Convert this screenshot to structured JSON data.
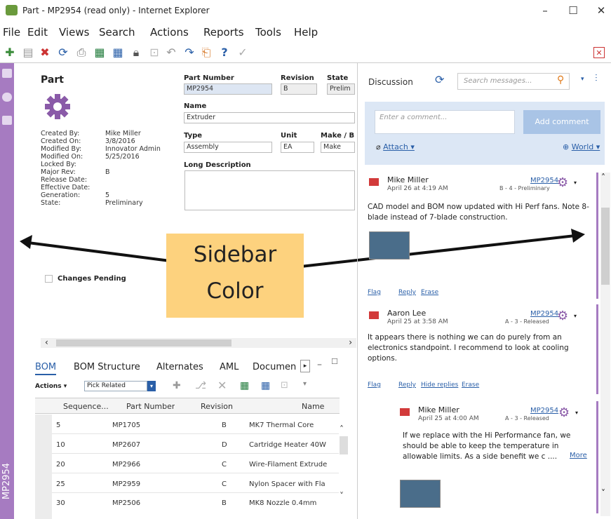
{
  "window": {
    "title": "Part - MP2954 (read only) - Internet Explorer",
    "min": "–",
    "max": "☐",
    "close": "✕"
  },
  "menu": [
    "File",
    "Edit",
    "Views",
    "Search",
    "Actions",
    "Reports",
    "Tools",
    "Help"
  ],
  "sidebar": {
    "color": "#a67bc1",
    "vertical_label": "MP2954"
  },
  "part": {
    "heading": "Part",
    "meta": [
      {
        "label": "Created By:",
        "value": "Mike Miller"
      },
      {
        "label": "Created On:",
        "value": "3/8/2016"
      },
      {
        "label": "Modified By:",
        "value": "Innovator Admin"
      },
      {
        "label": "Modified On:",
        "value": "5/25/2016"
      },
      {
        "label": "Locked By:",
        "value": ""
      },
      {
        "label": "Major Rev:",
        "value": "B"
      },
      {
        "label": "Release Date:",
        "value": ""
      },
      {
        "label": "Effective Date:",
        "value": ""
      },
      {
        "label": "Generation:",
        "value": "5"
      },
      {
        "label": "State:",
        "value": "Preliminary"
      }
    ],
    "fields": {
      "part_number_label": "Part Number",
      "part_number": "MP2954",
      "revision_label": "Revision",
      "revision": "B",
      "state_label": "State",
      "state": "Prelim",
      "name_label": "Name",
      "name": "Extruder",
      "type_label": "Type",
      "type": "Assembly",
      "unit_label": "Unit",
      "unit": "EA",
      "make_buy_label": "Make / B",
      "make_buy": "Make",
      "long_desc_label": "Long Description"
    },
    "changes_pending": "Changes Pending"
  },
  "callout": {
    "line1": "Sidebar",
    "line2": "Color"
  },
  "tabs": {
    "items": [
      "BOM",
      "BOM Structure",
      "Alternates",
      "AML",
      "Documen"
    ],
    "actions": "Actions ▾",
    "pick_related": "Pick Related"
  },
  "bom": {
    "columns": [
      "Sequence...",
      "Part Number",
      "Revision",
      "Name"
    ],
    "rows": [
      [
        "5",
        "MP1705",
        "B",
        "MK7 Thermal Core"
      ],
      [
        "10",
        "MP2607",
        "D",
        "Cartridge Heater 40W"
      ],
      [
        "20",
        "MP2966",
        "C",
        "Wire-Filament Extrude"
      ],
      [
        "25",
        "MP2959",
        "C",
        "Nylon Spacer with Fla"
      ],
      [
        "30",
        "MP2506",
        "B",
        "MK8 Nozzle 0.4mm"
      ]
    ]
  },
  "discussion": {
    "title": "Discussion",
    "search_placeholder": "Search messages...",
    "comment_placeholder": "Enter a comment...",
    "add_comment": "Add comment",
    "attach": "Attach ▾",
    "world": "World ▾",
    "posts": [
      {
        "author": "Mike Miller",
        "date": "April 26 at 4:19 AM",
        "item": "MP2954",
        "rev": "B - 4 - Preliminary",
        "text": "CAD model and BOM now updated with Hi Perf fans. Note 8-blade instead of 7-blade construction.",
        "links": [
          "Flag",
          "Reply",
          "Erase"
        ]
      },
      {
        "author": "Aaron Lee",
        "date": "April 25 at 3:58 AM",
        "item": "MP2954",
        "rev": "A - 3 - Released",
        "text": "It appears there is nothing we can do purely from an electronics standpoint. I recommend to look at cooling options.",
        "links": [
          "Flag",
          "Reply",
          "Hide replies",
          "Erase"
        ]
      },
      {
        "author": "Mike Miller",
        "date": "April 25 at 4:00 AM",
        "item": "MP2954",
        "rev": "A - 3 - Released",
        "text": "If we replace with the Hi Performance fan, we should be able to keep the temperature in allowable limits. As a side benefit we c ....",
        "more": "More"
      }
    ]
  }
}
